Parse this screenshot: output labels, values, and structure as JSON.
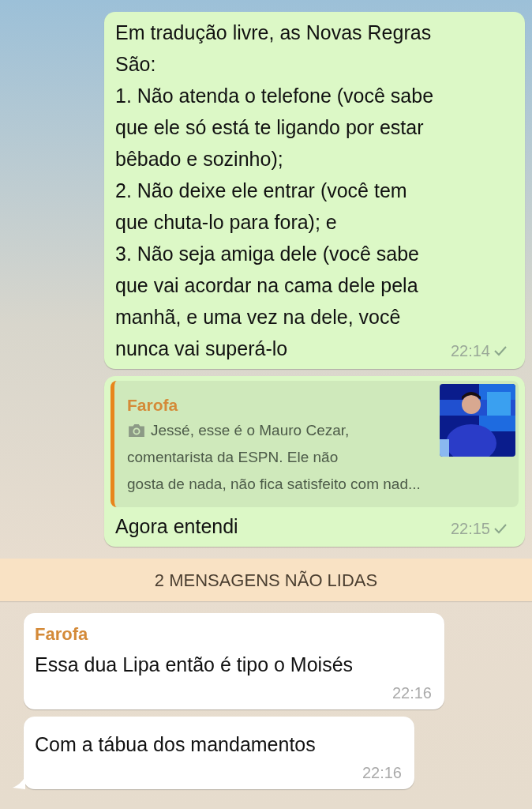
{
  "messages": [
    {
      "kind": "outgoing",
      "text": "Em tradução livre, as Novas Regras\nSão:\n1. Não atenda o telefone (você sabe\nque ele só está te ligando por estar\nbêbado e sozinho);\n2. Não deixe ele entrar (você tem\nque chuta-lo para fora); e\n3. Não seja amiga dele (você sabe\nque vai acordar na cama dele pela\nmanhã, e uma vez na dele, você\nnunca vai superá-lo",
      "time": "22:14"
    },
    {
      "kind": "outgoing",
      "quote": {
        "sender": "Farofa",
        "lines": [
          "Jessé, esse é o Mauro Cezar,",
          "comentarista da ESPN. Ele não",
          "gosta de nada, não fica satisfeito com nad..."
        ]
      },
      "text": "Agora entendi",
      "time": "22:15"
    },
    {
      "kind": "divider",
      "text": "2 MENSAGENS NÃO LIDAS"
    },
    {
      "kind": "incoming",
      "sender": "Farofa",
      "text": "Essa dua Lipa então é tipo o Moisés",
      "time": "22:16"
    },
    {
      "kind": "incoming",
      "text": "Com a tábua dos mandamentos",
      "time": "22:16",
      "tail": true
    }
  ]
}
